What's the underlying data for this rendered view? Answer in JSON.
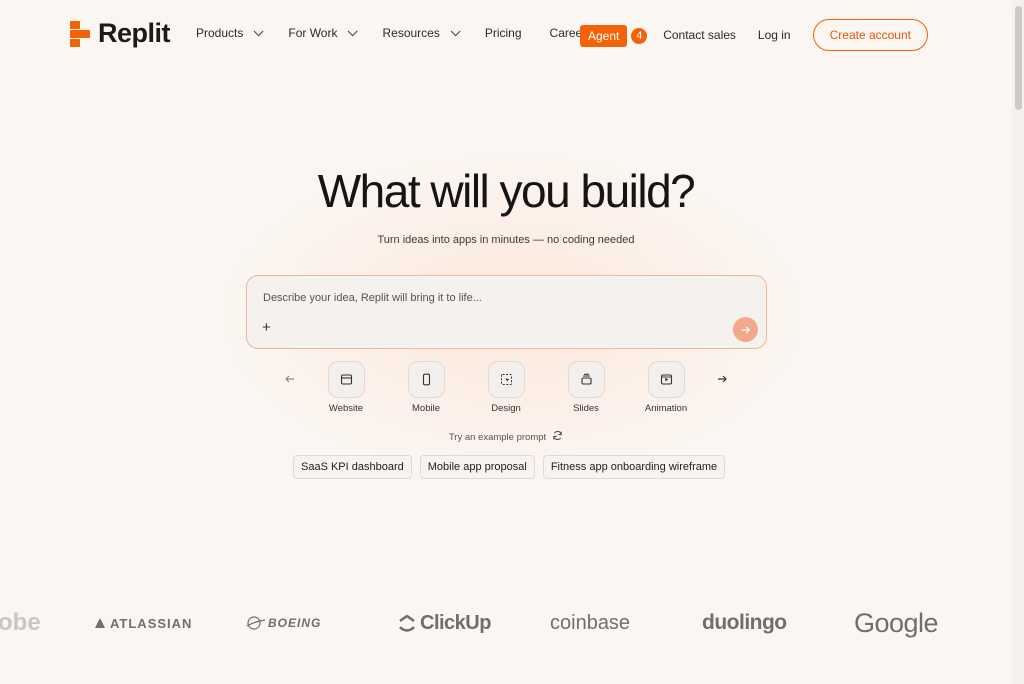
{
  "header": {
    "brand": "Replit",
    "nav": [
      {
        "label": "Products",
        "has_dropdown": true
      },
      {
        "label": "For Work",
        "has_dropdown": true
      },
      {
        "label": "Resources",
        "has_dropdown": true
      },
      {
        "label": "Pricing",
        "has_dropdown": false
      },
      {
        "label": "Careers",
        "has_dropdown": false
      }
    ],
    "agent_label": "Agent",
    "agent_count": "4",
    "contact_sales": "Contact sales",
    "login": "Log in",
    "create_account": "Create account"
  },
  "hero": {
    "title": "What will you build?",
    "subtitle": "Turn ideas into apps in minutes — no coding needed"
  },
  "prompt": {
    "placeholder": "Describe your idea, Replit will bring it to life...",
    "plus_icon": "plus-icon",
    "send_icon": "arrow-right-icon"
  },
  "app_types": [
    {
      "label": "Website",
      "icon": "browser-window-icon"
    },
    {
      "label": "Mobile",
      "icon": "phone-icon"
    },
    {
      "label": "Design",
      "icon": "cursor-select-icon"
    },
    {
      "label": "Slides",
      "icon": "slides-stack-icon"
    },
    {
      "label": "Animation",
      "icon": "play-frame-icon"
    }
  ],
  "examples": {
    "heading": "Try an example prompt",
    "chips": [
      "SaaS KPI dashboard",
      "Mobile app proposal",
      "Fitness app onboarding wireframe"
    ]
  },
  "customer_logos": [
    "Adobe",
    "ATLASSIAN",
    "BOEING",
    "ClickUp",
    "coinbase",
    "duolingo",
    "Google"
  ],
  "colors": {
    "accent": "#f26207",
    "background": "#fbf6f2",
    "send_button": "#f3a88a"
  }
}
